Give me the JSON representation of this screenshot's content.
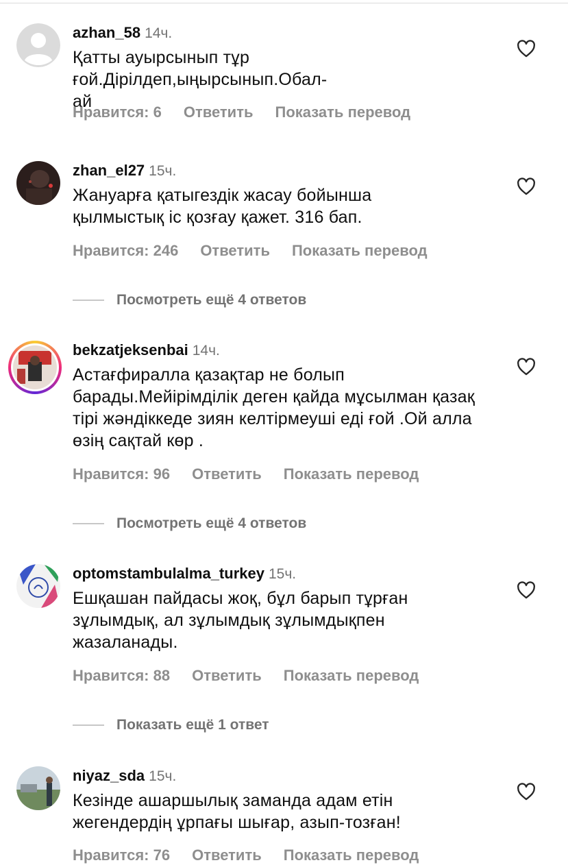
{
  "comments": [
    {
      "username": "azhan_58",
      "time": "14ч.",
      "text": "Қатты ауырсынып тұр ғой.Дірілдеп,ыңырсынып.Обал-ай",
      "likes": "Нравится: 6",
      "reply": "Ответить",
      "translate": "Показать перевод"
    },
    {
      "username": "zhan_el27",
      "time": "15ч.",
      "text": "Жануарға қатыгездік жасау бойынша қылмыстық іс қозғау қажет.  316 бап.",
      "likes": "Нравится: 246",
      "reply": "Ответить",
      "translate": "Показать перевод",
      "more_replies": "Посмотреть ещё 4 ответов"
    },
    {
      "username": "bekzatjeksenbai",
      "time": "14ч.",
      "text": "Астағфиралла қазақтар не болып барады.Мейірімділік деген қайда мұсылман қазақ тірі жәндіккеде зиян келтірмеуші еді ғой .Ой алла өзің сақтай көр .",
      "likes": "Нравится: 96",
      "reply": "Ответить",
      "translate": "Показать перевод",
      "more_replies": "Посмотреть ещё 4 ответов"
    },
    {
      "username": "optomstambulalma_turkey",
      "time": "15ч.",
      "text": "Ешқашан пайдасы жоқ, бұл барып тұрған зұлымдық, ал зұлымдық зұлымдықпен жазаланады.",
      "likes": "Нравится: 88",
      "reply": "Ответить",
      "translate": "Показать перевод",
      "more_replies": "Показать ещё 1 ответ"
    },
    {
      "username": "niyaz_sda",
      "time": "15ч.",
      "text": "Кезінде ашаршылық заманда адам етін жегендердің ұрпағы шығар, азып-тозған!",
      "likes": "Нравится: 76",
      "reply": "Ответить",
      "translate": "Показать перевод"
    }
  ],
  "icons": {
    "like": "heart-outline-icon",
    "default_avatar": "default-avatar-icon"
  },
  "colors": {
    "text": "#0f0f0f",
    "secondary": "#737373",
    "actions": "#8e8e8e",
    "story_ring": [
      "#f9ce34",
      "#ee2a7b",
      "#6228d7"
    ]
  }
}
